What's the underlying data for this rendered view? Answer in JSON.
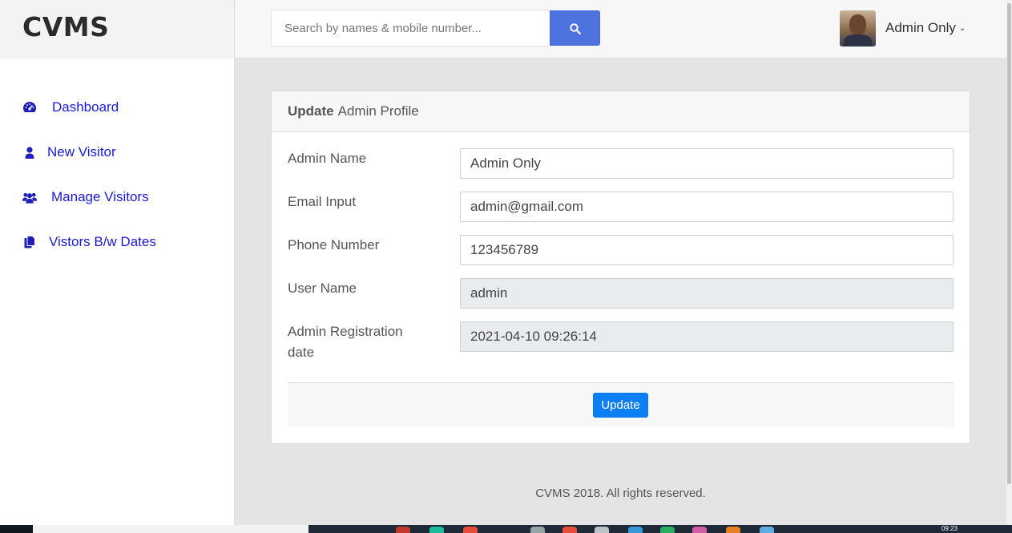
{
  "brand": "CVMS",
  "search": {
    "placeholder": "Search by names & mobile number..."
  },
  "user": {
    "name": "Admin Only",
    "caret": "⌄"
  },
  "sidebar": {
    "items": [
      {
        "label": "Dashboard",
        "icon": "dashboard-icon"
      },
      {
        "label": "New Visitor",
        "icon": "user-icon"
      },
      {
        "label": "Manage Visitors",
        "icon": "users-icon"
      },
      {
        "label": "Vistors B/w Dates",
        "icon": "copy-icon"
      }
    ]
  },
  "card": {
    "title_bold": "Update",
    "title_rest": "Admin Profile",
    "fields": [
      {
        "label": "Admin Name",
        "value": "Admin Only"
      },
      {
        "label": "Email Input",
        "value": "admin@gmail.com"
      },
      {
        "label": "Phone Number",
        "value": "123456789"
      },
      {
        "label": "User Name",
        "value": "admin"
      },
      {
        "label": "Admin Registration date",
        "value": "2021-04-10 09:26:14"
      }
    ],
    "button": "Update"
  },
  "footer": "CVMS 2018. All rights reserved.",
  "taskbar": {
    "clock": "09:23"
  },
  "colors": {
    "accent": "#4e73df",
    "primary_button": "#0d7ff5",
    "nav_link": "#1a1ad4"
  }
}
